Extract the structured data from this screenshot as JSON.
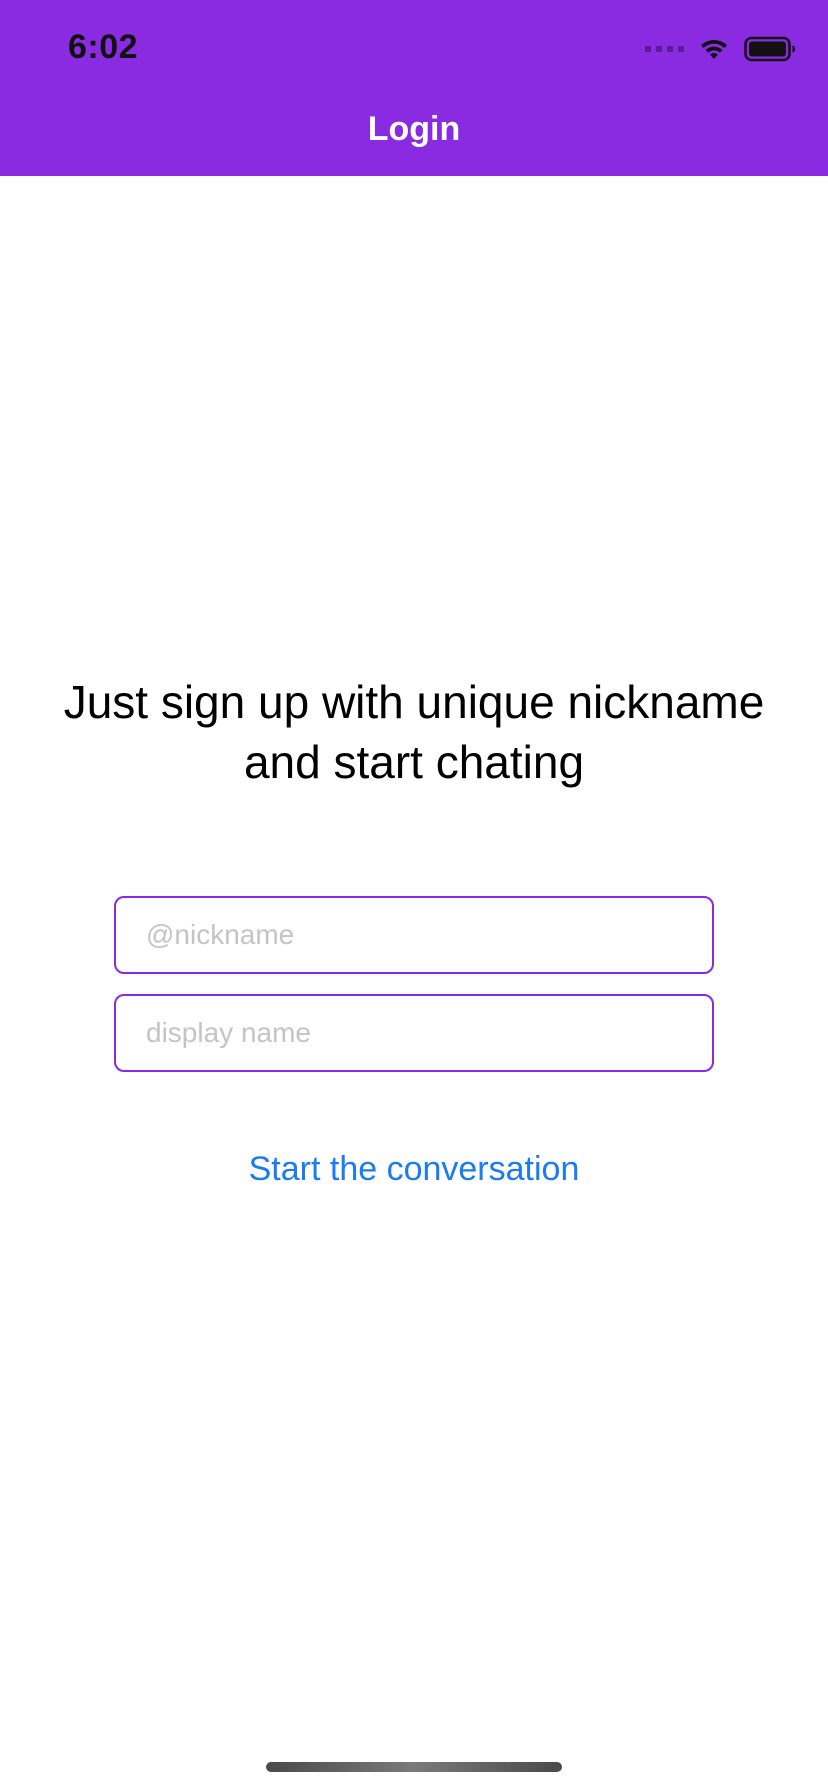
{
  "status_bar": {
    "time": "6:02",
    "icons": [
      "signal-icon",
      "wifi-icon",
      "battery-icon"
    ]
  },
  "nav": {
    "title": "Login",
    "background": "#8a2be2"
  },
  "main": {
    "headline": "Just sign up with unique nickname and start chating",
    "nickname_placeholder": "@nickname",
    "display_name_placeholder": "display name",
    "cta_label": "Start the conversation"
  },
  "colors": {
    "accent": "#8a2be2",
    "link": "#1a7bf2"
  }
}
